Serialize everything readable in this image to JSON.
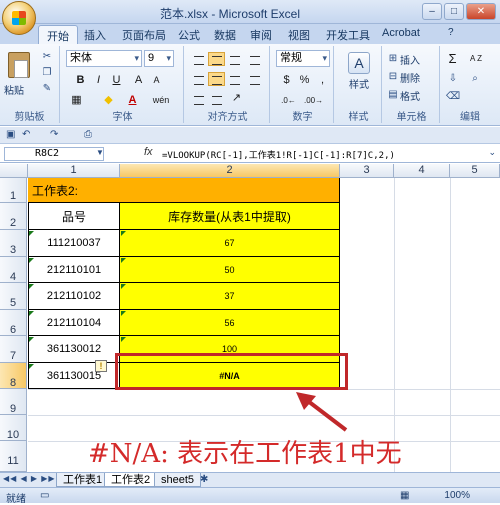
{
  "window": {
    "title": "范本.xlsx - Microsoft Excel"
  },
  "ribbon": {
    "tabs": [
      "开始",
      "插入",
      "页面布局",
      "公式",
      "数据",
      "审阅",
      "视图",
      "开发工具",
      "Acrobat"
    ],
    "clipboard": {
      "paste": "粘贴",
      "label": "剪贴板"
    },
    "font": {
      "name": "宋体",
      "size": "9",
      "label": "字体",
      "bold": "B",
      "italic": "I",
      "underline": "U",
      "grow": "A",
      "shrink": "A",
      "fill": "◆",
      "fontcolor": "A",
      "phonetic": "wén"
    },
    "alignment": {
      "label": "对齐方式"
    },
    "number": {
      "format": "常规",
      "label": "数字",
      "currency": "$",
      "percent": "%",
      "comma": ","
    },
    "styles": {
      "label": "样式",
      "btn": "样式"
    },
    "cells": {
      "insert": "插入",
      "delete": "删除",
      "format": "格式",
      "label": "单元格"
    },
    "editing": {
      "sum": "Σ",
      "sort": "A Z",
      "label": "编辑"
    }
  },
  "formula_bar": {
    "name_box": "R8C2",
    "fx": "fx",
    "formula": "=VLOOKUP(RC[-1],工作表1!R[-1]C[-1]:R[7]C,2,)"
  },
  "columns": [
    "1",
    "2",
    "3",
    "4",
    "5"
  ],
  "rows": [
    "1",
    "2",
    "3",
    "4",
    "5",
    "6",
    "7",
    "8",
    "9",
    "10",
    "11"
  ],
  "sheet": {
    "title": "工作表2:",
    "header": {
      "col1": "品号",
      "col2": "库存数量(从表1中提取)"
    },
    "data": [
      {
        "code": "111210037",
        "qty": "67"
      },
      {
        "code": "212110101",
        "qty": "50"
      },
      {
        "code": "212110102",
        "qty": "37"
      },
      {
        "code": "212110104",
        "qty": "56"
      },
      {
        "code": "361130012",
        "qty": "100"
      },
      {
        "code": "361130015",
        "qty": "#N/A"
      }
    ]
  },
  "annotation": "#N/A: 表示在工作表1中无",
  "sheet_tabs": [
    "工作表1",
    "工作表2",
    "sheet5"
  ],
  "status": {
    "ready": "就绪",
    "zoom": "100%"
  },
  "colors": {
    "title_fill": "#ffb000",
    "yellow_fill": "#ffff00",
    "annotation": "#d42a2a",
    "highlight_box": "#c0282a"
  }
}
